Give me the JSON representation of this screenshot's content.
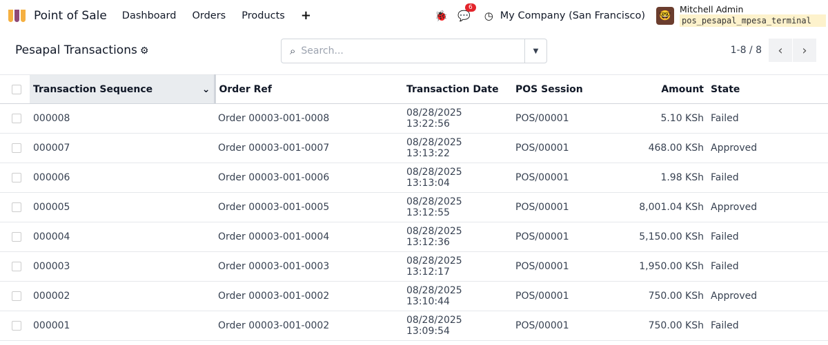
{
  "navbar": {
    "app": "Point of Sale",
    "menu": [
      "Dashboard",
      "Orders",
      "Products"
    ],
    "messages_count": "6",
    "company": "My Company (San Francisco)",
    "user": "Mitchell Admin",
    "database": "pos_pesapal_mpesa_terminal"
  },
  "control": {
    "title": "Pesapal Transactions",
    "search_placeholder": "Search...",
    "pager": "1-8 / 8"
  },
  "columns": [
    "Transaction Sequence",
    "Order Ref",
    "Transaction Date",
    "POS Session",
    "Amount",
    "State"
  ],
  "rows": [
    [
      "000008",
      "Order 00003-001-0008",
      "08/28/2025 13:22:56",
      "POS/00001",
      "5.10 KSh",
      "Failed"
    ],
    [
      "000007",
      "Order 00003-001-0007",
      "08/28/2025 13:13:22",
      "POS/00001",
      "468.00 KSh",
      "Approved"
    ],
    [
      "000006",
      "Order 00003-001-0006",
      "08/28/2025 13:13:04",
      "POS/00001",
      "1.98 KSh",
      "Failed"
    ],
    [
      "000005",
      "Order 00003-001-0005",
      "08/28/2025 13:12:55",
      "POS/00001",
      "8,001.04 KSh",
      "Approved"
    ],
    [
      "000004",
      "Order 00003-001-0004",
      "08/28/2025 13:12:36",
      "POS/00001",
      "5,150.00 KSh",
      "Failed"
    ],
    [
      "000003",
      "Order 00003-001-0003",
      "08/28/2025 13:12:17",
      "POS/00001",
      "1,950.00 KSh",
      "Failed"
    ],
    [
      "000002",
      "Order 00003-001-0002",
      "08/28/2025 13:10:44",
      "POS/00001",
      "750.00 KSh",
      "Approved"
    ],
    [
      "000001",
      "Order 00003-001-0002",
      "08/28/2025 13:09:54",
      "POS/00001",
      "750.00 KSh",
      "Failed"
    ]
  ]
}
